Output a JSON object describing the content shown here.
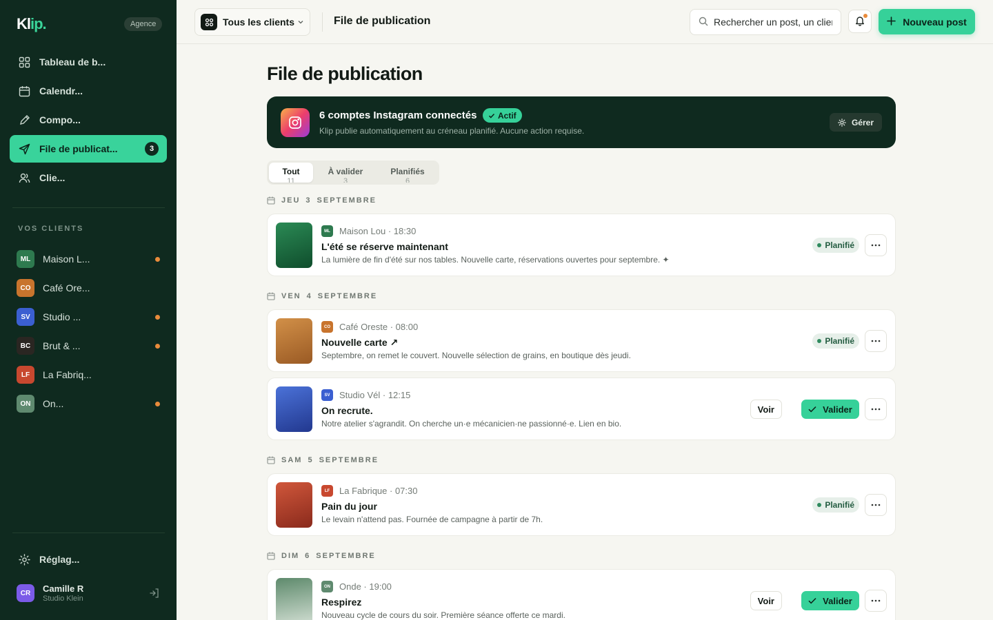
{
  "brand": {
    "logo_main": "Kl",
    "logo_accent": "ip.",
    "badge": "Agence"
  },
  "nav": [
    {
      "label": "Tableau de b...",
      "icon": "grid-icon"
    },
    {
      "label": "Calendr...",
      "icon": "calendar-icon"
    },
    {
      "label": "Compo...",
      "icon": "pencil-icon"
    },
    {
      "label": "File de publicat...",
      "icon": "send-icon",
      "count": "3",
      "active": true
    },
    {
      "label": "Clie...",
      "icon": "users-icon"
    }
  ],
  "clients_section": {
    "title": "VOS CLIENTS"
  },
  "clients": [
    {
      "initials": "ML",
      "name": "Maison L...",
      "color": "#2e7a4f",
      "dot": true
    },
    {
      "initials": "CO",
      "name": "Café Ore...",
      "color": "#c8742d",
      "dot": false
    },
    {
      "initials": "SV",
      "name": "Studio ...",
      "color": "#3b5fd1",
      "dot": true
    },
    {
      "initials": "BC",
      "name": "Brut & ...",
      "color": "#2a2622",
      "dot": true
    },
    {
      "initials": "LF",
      "name": "La Fabriq...",
      "color": "#c8482f",
      "dot": false
    },
    {
      "initials": "ON",
      "name": "On...",
      "color": "#5f8a6f",
      "dot": true
    }
  ],
  "settings": {
    "label": "Réglag..."
  },
  "user": {
    "initials": "CR",
    "name": "Camille R",
    "subtitle": "Studio Klein"
  },
  "topbar": {
    "client_select": "Tous les clients",
    "title": "File de publication",
    "search_placeholder": "Rechercher un post, un client...",
    "new_post": "Nouveau post"
  },
  "page": {
    "title": "File de publication"
  },
  "banner": {
    "title": "6 comptes Instagram connectés",
    "status": "Actif",
    "subtitle": "Klip publie automatiquement au créneau planifié. Aucune action requise.",
    "manage": "Gérer"
  },
  "tabs": [
    {
      "label": "Tout",
      "count": "11",
      "active": true
    },
    {
      "label": "À valider",
      "count": "3"
    },
    {
      "label": "Planifiés",
      "count": "6"
    }
  ],
  "days": [
    {
      "weekday": "JEU",
      "date": "3",
      "month": "SEPTEMBRE",
      "posts": [
        {
          "client": "Maison Lou",
          "initials": "ML",
          "color": "#2e7a4f",
          "thumb": [
            "#2b8a55",
            "#0f4d2c"
          ],
          "time": "18:30",
          "title": "L'été se réserve maintenant",
          "desc": "La lumière de fin d'été sur nos tables. Nouvelle carte, réservations ouvertes pour septembre. ✦",
          "status": "Planifié"
        }
      ]
    },
    {
      "weekday": "VEN",
      "date": "4",
      "month": "SEPTEMBRE",
      "posts": [
        {
          "client": "Café Oreste",
          "initials": "CO",
          "color": "#c8742d",
          "thumb": [
            "#d29048",
            "#9a5a24"
          ],
          "time": "08:00",
          "title": "Nouvelle carte ↗",
          "desc": "Septembre, on remet le couvert. Nouvelle sélection de grains, en boutique dès jeudi.",
          "status": "Planifié"
        },
        {
          "client": "Studio Vél",
          "initials": "SV",
          "color": "#3b5fd1",
          "thumb": [
            "#4b72d8",
            "#22388f"
          ],
          "time": "12:15",
          "title": "On recrute.",
          "desc": "Notre atelier s'agrandit. On cherche un·e mécanicien·ne passionné·e. Lien en bio.",
          "voir": "Voir",
          "valider": "Valider"
        }
      ]
    },
    {
      "weekday": "SAM",
      "date": "5",
      "month": "SEPTEMBRE",
      "posts": [
        {
          "client": "La Fabrique",
          "initials": "LF",
          "color": "#c8482f",
          "thumb": [
            "#d0573b",
            "#8a2a1c"
          ],
          "time": "07:30",
          "title": "Pain du jour",
          "desc": "Le levain n'attend pas. Fournée de campagne à partir de 7h.",
          "status": "Planifié"
        }
      ]
    },
    {
      "weekday": "DIM",
      "date": "6",
      "month": "SEPTEMBRE",
      "posts": [
        {
          "client": "Onde",
          "initials": "ON",
          "color": "#5f8a6f",
          "thumb": [
            "#5e8a6c",
            "#c9d8cb"
          ],
          "time": "19:00",
          "title": "Respirez",
          "desc": "Nouveau cycle de cours du soir. Première séance offerte ce mardi.",
          "voir": "Voir",
          "valider": "Valider"
        }
      ]
    }
  ]
}
